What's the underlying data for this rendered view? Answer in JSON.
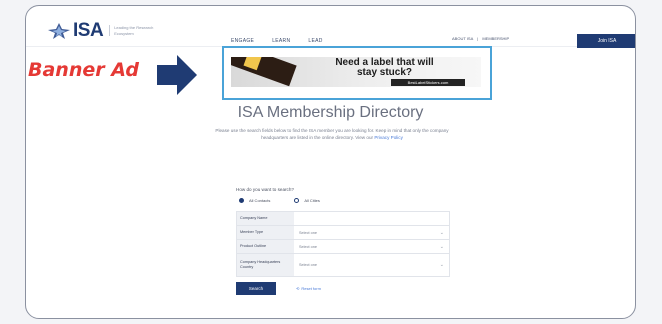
{
  "header": {
    "logo_text": "ISA",
    "logo_tagline": "Leading the Research Ecosystem",
    "nav": [
      "ENGAGE",
      "LEARN",
      "LEAD"
    ],
    "util": [
      "ABOUT ISA",
      "MEMBERSHIP"
    ],
    "join_label": "Join ISA"
  },
  "ad": {
    "headline": "Need a label that will stay stuck?",
    "url": "BestLabelStickers.com"
  },
  "annotation": {
    "label": "Banner Ad"
  },
  "main": {
    "title": "ISA Membership Directory",
    "intro": "Please use the search fields below to find the ISA member you are looking for. Keep in mind that only the company headquarters are listed in the online directory. View our",
    "privacy_link": "Privacy Policy",
    "question": "How do you want to search?",
    "radios": [
      "All Contacts",
      "All Cities"
    ],
    "fields": [
      {
        "label": "Company Name",
        "value": ""
      },
      {
        "label": "Member Type",
        "value": "Select one"
      },
      {
        "label": "Product Outline",
        "value": "Select one"
      },
      {
        "label": "Company Headquarters Country",
        "value": "Select one"
      }
    ],
    "search_label": "Search",
    "reset_label": "Reset form"
  }
}
